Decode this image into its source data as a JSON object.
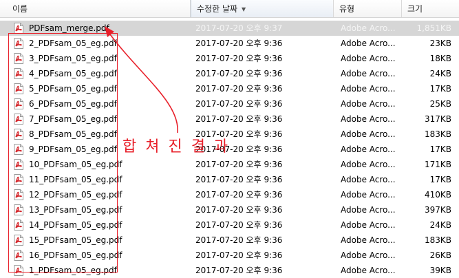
{
  "header": {
    "col_name": "이름",
    "col_date": "수정한 날짜",
    "col_type": "유형",
    "col_size": "크기",
    "sort_glyph": "▼"
  },
  "files": [
    {
      "name": "PDFsam_merge.pdf",
      "date": "2017-07-20 오후 9:37",
      "type": "Adobe Acro...",
      "size": "1,851KB",
      "selected": true
    },
    {
      "name": "2_PDFsam_05_eg.pdf",
      "date": "2017-07-20 오후 9:36",
      "type": "Adobe Acro...",
      "size": "23KB"
    },
    {
      "name": "3_PDFsam_05_eg.pdf",
      "date": "2017-07-20 오후 9:36",
      "type": "Adobe Acro...",
      "size": "18KB"
    },
    {
      "name": "4_PDFsam_05_eg.pdf",
      "date": "2017-07-20 오후 9:36",
      "type": "Adobe Acro...",
      "size": "24KB"
    },
    {
      "name": "5_PDFsam_05_eg.pdf",
      "date": "2017-07-20 오후 9:36",
      "type": "Adobe Acro...",
      "size": "17KB"
    },
    {
      "name": "6_PDFsam_05_eg.pdf",
      "date": "2017-07-20 오후 9:36",
      "type": "Adobe Acro...",
      "size": "25KB"
    },
    {
      "name": "7_PDFsam_05_eg.pdf",
      "date": "2017-07-20 오후 9:36",
      "type": "Adobe Acro...",
      "size": "317KB"
    },
    {
      "name": "8_PDFsam_05_eg.pdf",
      "date": "2017-07-20 오후 9:36",
      "type": "Adobe Acro...",
      "size": "183KB"
    },
    {
      "name": "9_PDFsam_05_eg.pdf",
      "date": "2017-07-20 오후 9:36",
      "type": "Adobe Acro...",
      "size": "17KB"
    },
    {
      "name": "10_PDFsam_05_eg.pdf",
      "date": "2017-07-20 오후 9:36",
      "type": "Adobe Acro...",
      "size": "171KB"
    },
    {
      "name": "11_PDFsam_05_eg.pdf",
      "date": "2017-07-20 오후 9:36",
      "type": "Adobe Acro...",
      "size": "17KB"
    },
    {
      "name": "12_PDFsam_05_eg.pdf",
      "date": "2017-07-20 오후 9:36",
      "type": "Adobe Acro...",
      "size": "410KB"
    },
    {
      "name": "13_PDFsam_05_eg.pdf",
      "date": "2017-07-20 오후 9:36",
      "type": "Adobe Acro...",
      "size": "397KB"
    },
    {
      "name": "14_PDFsam_05_eg.pdf",
      "date": "2017-07-20 오후 9:36",
      "type": "Adobe Acro...",
      "size": "24KB"
    },
    {
      "name": "15_PDFsam_05_eg.pdf",
      "date": "2017-07-20 오후 9:36",
      "type": "Adobe Acro...",
      "size": "183KB"
    },
    {
      "name": "16_PDFsam_05_eg.pdf",
      "date": "2017-07-20 오후 9:36",
      "type": "Adobe Acro...",
      "size": "26KB"
    },
    {
      "name": "1_PDFsam_05_eg.pdf",
      "date": "2017-07-20 오후 9:36",
      "type": "Adobe Acro...",
      "size": "39KB"
    }
  ],
  "annotation": {
    "text": "합 쳐 진 결 과",
    "color": "#e8202a"
  },
  "icons": {
    "file_icon": "pdf-file-icon"
  }
}
